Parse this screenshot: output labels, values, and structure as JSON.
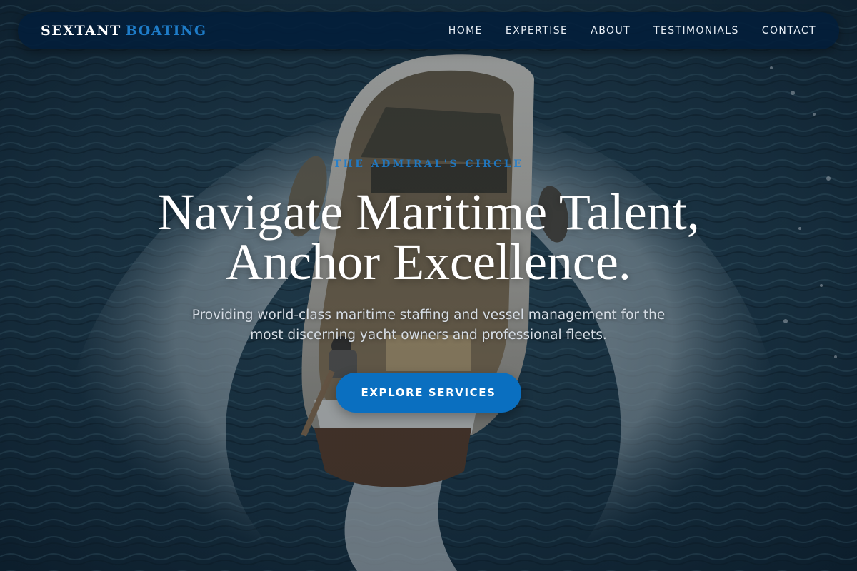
{
  "brand": {
    "primary": "SEXTANT",
    "accent": "BOATING"
  },
  "nav": {
    "items": [
      {
        "label": "HOME"
      },
      {
        "label": "EXPERTISE"
      },
      {
        "label": "ABOUT"
      },
      {
        "label": "TESTIMONIALS"
      },
      {
        "label": "CONTACT"
      }
    ]
  },
  "hero": {
    "eyebrow": "THE ADMIRAL'S CIRCLE",
    "headline_line1": "Navigate Maritime Talent,",
    "headline_line2": "Anchor Excellence.",
    "subtitle": "Providing world-class maritime staffing and vessel management for the most discerning yacht owners and professional fleets.",
    "cta_label": "EXPLORE SERVICES"
  },
  "colors": {
    "accent": "#1e7cc8",
    "button": "#0a6fc0",
    "navbar": "#021e3a"
  }
}
